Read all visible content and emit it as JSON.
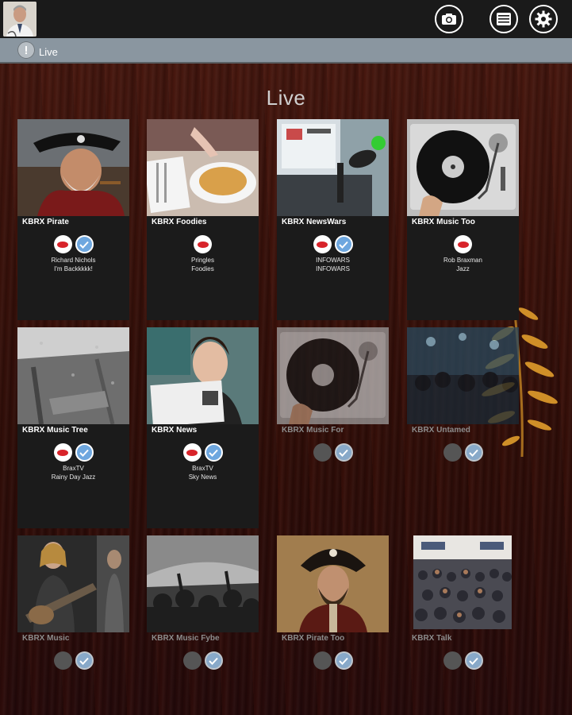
{
  "header": {
    "avatar": "user-avatar",
    "buttons": [
      {
        "name": "camera-button",
        "icon": "camera-icon"
      },
      {
        "name": "menu-button",
        "icon": "list-icon"
      },
      {
        "name": "settings-button",
        "icon": "gear-icon"
      }
    ]
  },
  "subbar": {
    "label": "Live",
    "icon": "info-icon"
  },
  "section_title": "Live",
  "colors": {
    "check": "#6ea7df",
    "red_logo": "#d8232a",
    "panel": "#1b1b1b",
    "subbar": "#8a96a0"
  },
  "tiles": [
    {
      "title": "KBRX Pirate",
      "active": true,
      "icons": [
        "red-logo",
        "check"
      ],
      "line1": "Richard Nichols",
      "line2": "I'm Backkkkk!"
    },
    {
      "title": "KBRX Foodies",
      "active": true,
      "icons": [
        "red-logo"
      ],
      "line1": "Pringles",
      "line2": "Foodies"
    },
    {
      "title": "KBRX NewsWars",
      "active": true,
      "icons": [
        "red-logo",
        "check"
      ],
      "line1": "INFOWARS",
      "line2": "INFOWARS"
    },
    {
      "title": "KBRX Music Too",
      "active": true,
      "icons": [
        "red-logo"
      ],
      "line1": "Rob Braxman",
      "line2": "Jazz"
    },
    {
      "title": "KBRX Music Tree",
      "active": true,
      "icons": [
        "red-logo",
        "check"
      ],
      "line1": "BraxTV",
      "line2": "Rainy Day Jazz"
    },
    {
      "title": "KBRX News",
      "active": true,
      "icons": [
        "red-logo",
        "check"
      ],
      "line1": "BraxTV",
      "line2": "Sky News"
    },
    {
      "title": "KBRX Music For",
      "active": false,
      "icons": [
        "grey",
        "check"
      ]
    },
    {
      "title": "KBRX Untamed",
      "active": false,
      "icons": [
        "grey",
        "check"
      ]
    },
    {
      "title": "KBRX Music",
      "active": false,
      "icons": [
        "grey",
        "check"
      ]
    },
    {
      "title": "KBRX Music Fybe",
      "active": false,
      "icons": [
        "grey",
        "check"
      ]
    },
    {
      "title": "KBRX Pirate Too",
      "active": false,
      "icons": [
        "grey",
        "check"
      ]
    },
    {
      "title": "KBRX Talk",
      "active": false,
      "icons": [
        "grey",
        "check"
      ]
    }
  ]
}
